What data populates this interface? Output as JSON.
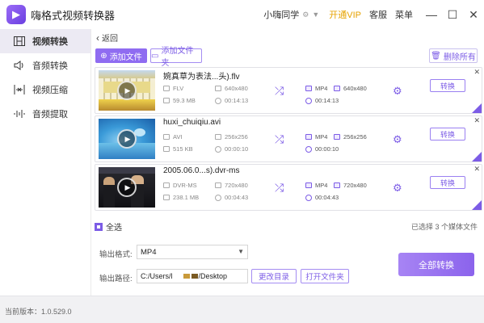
{
  "app": {
    "title": "嗨格式视频转换器",
    "user_name": "小嗨同学",
    "vip_label": "开通VIP",
    "service_label": "客服",
    "menu_label": "菜单"
  },
  "sidebar": {
    "items": [
      {
        "label": "视频转换",
        "icon": "film-icon",
        "active": true
      },
      {
        "label": "音频转换",
        "icon": "speaker-icon",
        "active": false
      },
      {
        "label": "视频压缩",
        "icon": "compress-icon",
        "active": false
      },
      {
        "label": "音频提取",
        "icon": "waveform-icon",
        "active": false
      }
    ]
  },
  "toolbar": {
    "back_label": "返回",
    "add_file_label": "添加文件",
    "add_folder_label": "添加文件夹",
    "delete_all_label": "删除所有"
  },
  "files": [
    {
      "name": "婉真草为表法...头).flv",
      "in_format": "FLV",
      "in_resolution": "640x480",
      "in_size": "59.3 MB",
      "in_duration": "00:14:13",
      "out_format": "MP4",
      "out_resolution": "640x480",
      "out_duration": "00:14:13",
      "convert_label": "转换"
    },
    {
      "name": "huxi_chuiqiu.avi",
      "in_format": "AVI",
      "in_resolution": "256x256",
      "in_size": "515 KB",
      "in_duration": "00:00:10",
      "out_format": "MP4",
      "out_resolution": "256x256",
      "out_duration": "00:00:10",
      "convert_label": "转换"
    },
    {
      "name": "2005.06.0...s).dvr-ms",
      "in_format": "DVR-MS",
      "in_resolution": "720x480",
      "in_size": "238.1 MB",
      "in_duration": "00:04:43",
      "out_format": "MP4",
      "out_resolution": "720x480",
      "out_duration": "00:04:43",
      "convert_label": "转换"
    }
  ],
  "footer": {
    "select_all_label": "全选",
    "selected_count_text": "已选择 3 个媒体文件",
    "output_format_label": "输出格式:",
    "output_format_value": "MP4",
    "output_path_label": "输出路径:",
    "output_path_prefix": "C:/Users/l",
    "output_path_suffix": "/Desktop",
    "change_dir_label": "更改目录",
    "open_folder_label": "打开文件夹",
    "convert_all_label": "全部转换"
  },
  "status": {
    "version_text": "当前版本：1.0.529.0"
  },
  "colors": {
    "accent": "#7c5ce6",
    "vip": "#e6a200"
  }
}
